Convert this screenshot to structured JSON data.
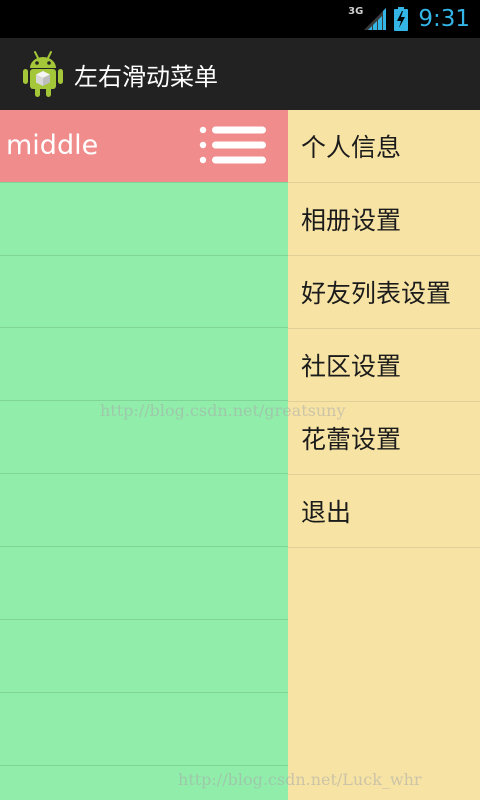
{
  "status_bar": {
    "network_type": "3G",
    "time": "9:31",
    "icons": [
      "signal-icon",
      "battery-charging-icon"
    ],
    "clock_color": "#33b5e5"
  },
  "action_bar": {
    "app_icon": "android-icon",
    "title": "左右滑动菜单"
  },
  "left_pane": {
    "header_label": "middle",
    "header_color": "#f08c8c",
    "toggle_icon": "list-menu-icon",
    "background": "#90eeaa"
  },
  "right_menu": {
    "background": "#f7e4a5",
    "items": [
      {
        "label": "个人信息"
      },
      {
        "label": "相册设置"
      },
      {
        "label": "好友列表设置"
      },
      {
        "label": "社区设置"
      },
      {
        "label": "花蕾设置"
      },
      {
        "label": "退出"
      }
    ]
  },
  "watermarks": {
    "center": "http://blog.csdn.net/greatsuny",
    "bottom": "http://blog.csdn.net/Luck_whr"
  }
}
